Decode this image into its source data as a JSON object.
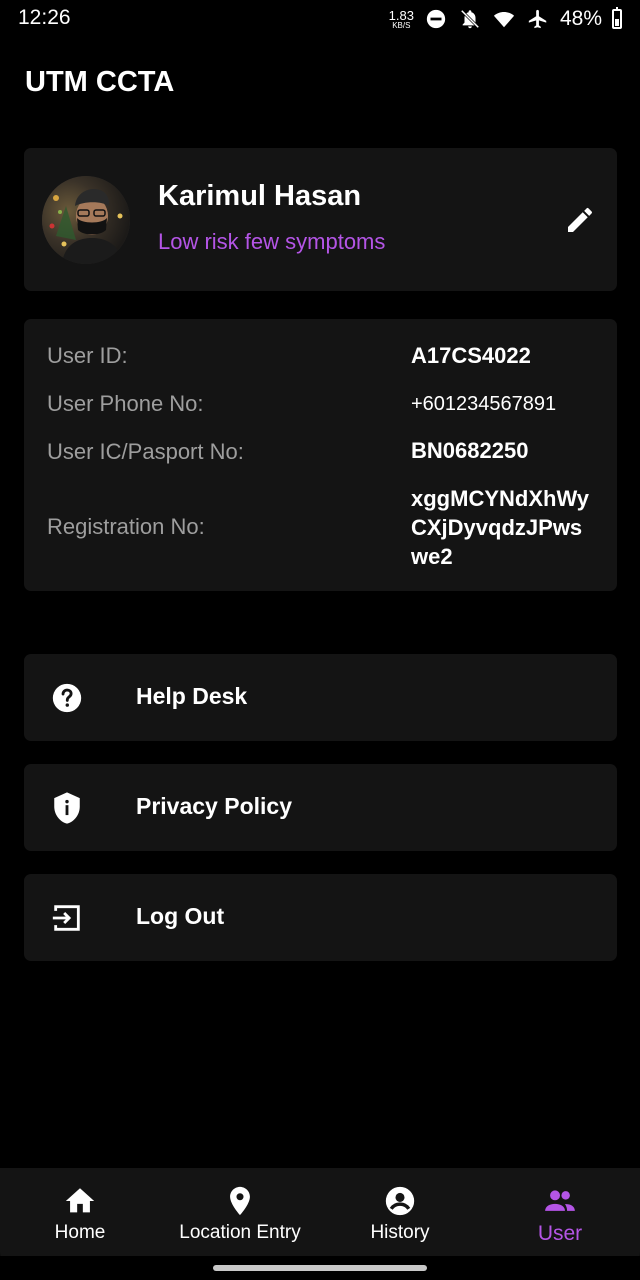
{
  "status_bar": {
    "time": "12:26",
    "net_speed_value": "1.83",
    "net_speed_unit": "KB/S",
    "battery_percent": "48%",
    "battery_level": 0.48
  },
  "app": {
    "title": "UTM CCTA"
  },
  "profile": {
    "name": "Karimul Hasan",
    "risk_status": "Low risk few symptoms",
    "risk_color": "#b455e6"
  },
  "info": {
    "user_id_label": "User ID:",
    "user_id_value": "A17CS4022",
    "phone_label": "User Phone No:",
    "phone_value": "+601234567891",
    "ic_label": "User IC/Pasport No:",
    "ic_value": "BN0682250",
    "registration_label": "Registration No:",
    "registration_value_line1": "xggMCYNdXhWy",
    "registration_value_line2": "CXjDyvqdzJPws",
    "registration_value_line3": "we2"
  },
  "menu": {
    "help_desk": {
      "label": "Help Desk",
      "icon": "help-circle-icon"
    },
    "privacy_policy": {
      "label": "Privacy Policy",
      "icon": "shield-info-icon"
    },
    "log_out": {
      "label": "Log Out",
      "icon": "exit-icon"
    }
  },
  "bottom_nav": {
    "home": {
      "label": "Home",
      "icon": "home-icon"
    },
    "location_entry": {
      "label": "Location Entry",
      "icon": "location-pin-icon"
    },
    "history": {
      "label": "History",
      "icon": "account-circle-icon"
    },
    "user": {
      "label": "User",
      "icon": "people-icon",
      "active": true
    }
  },
  "colors": {
    "accent": "#b455e6",
    "card": "#141414",
    "background": "#000000",
    "label_gray": "#9e9e9e"
  }
}
